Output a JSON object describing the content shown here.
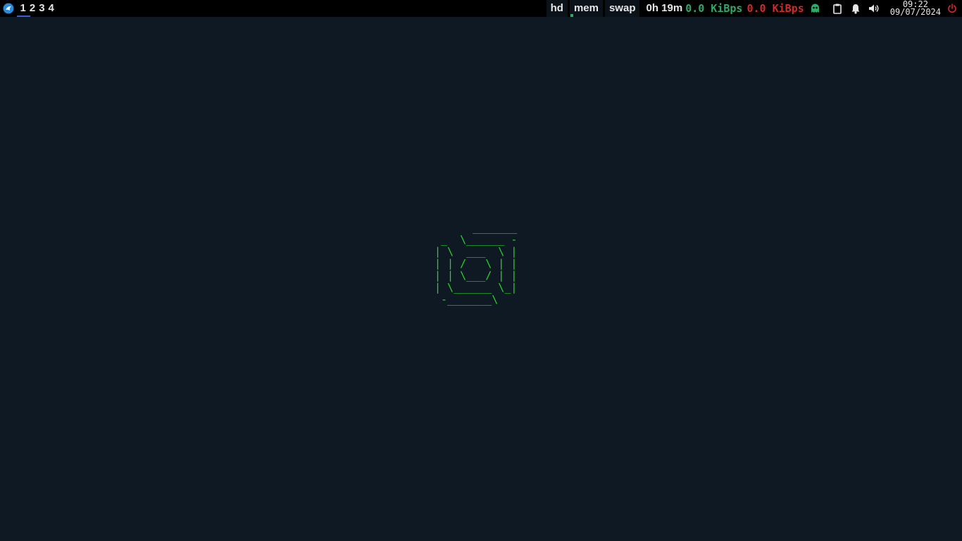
{
  "taskbar": {
    "logo_icon": "distro-logo-icon",
    "workspaces": [
      "1",
      "2",
      "3",
      "4"
    ],
    "active_workspace": "1",
    "modules": {
      "hd": "hd",
      "mem": "mem",
      "swap": "swap",
      "uptime": "0h 19m",
      "net_up": "0.0 KiBps",
      "net_down": "0.0 KiBps"
    },
    "tray_icons": [
      "ghost-icon",
      "clipboard-icon",
      "bell-icon",
      "volume-icon"
    ],
    "clock": {
      "time": "09:22",
      "date": "09/07/2024"
    },
    "power_icon": "power-icon",
    "colors": {
      "bar_bg": "#000000",
      "up": "#2fa86a",
      "down": "#d22a2a",
      "power": "#d22a2a",
      "accent_underline": "#3a5fd0"
    }
  },
  "desktop": {
    "background": "#0f1924",
    "ascii_color": "#23d42a",
    "ascii_art": "      _______\n _  \\______ -\n| \\  ___  \\ |\n| | /   \\ | |\n| | \\___/ | |\n| \\______ \\_|\n -_______\\"
  }
}
